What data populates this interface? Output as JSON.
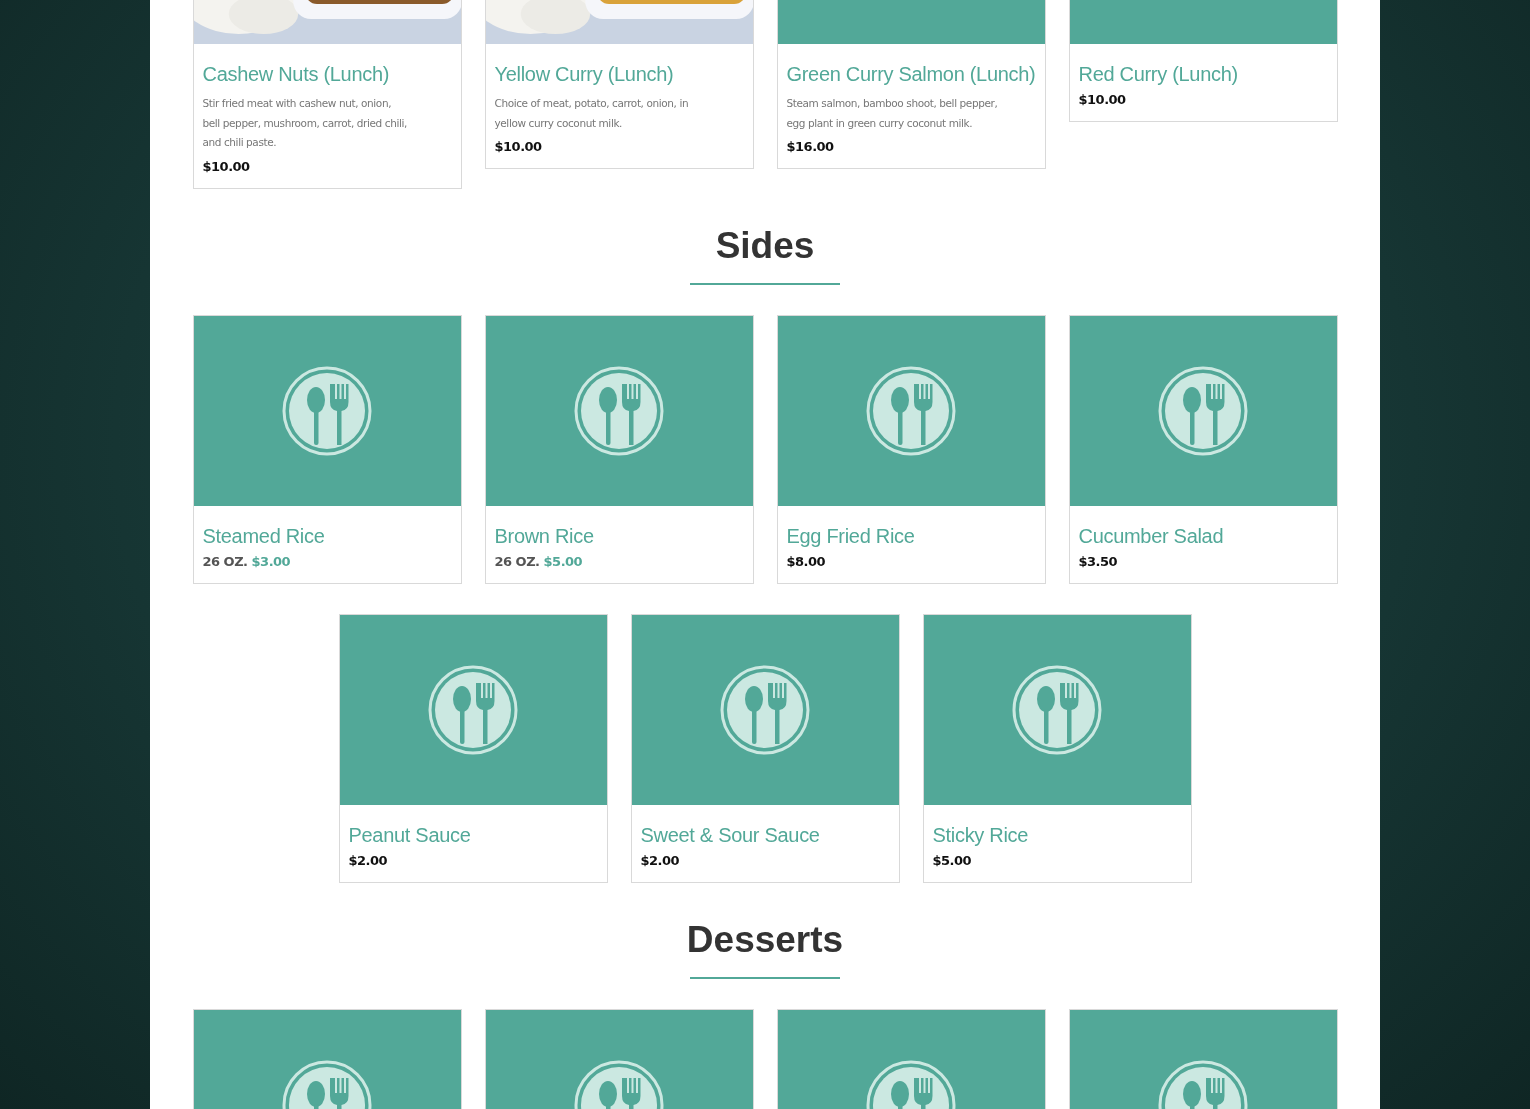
{
  "sections": [
    {
      "items": [
        {
          "name": "Cashew Nuts (Lunch)",
          "description": [
            "Stir fried meat with cashew nut, onion,",
            "bell pepper, mushroom, carrot, dried chili,",
            "and chili paste."
          ],
          "price": "$10.00"
        },
        {
          "name": "Yellow Curry (Lunch)",
          "description": [
            "Choice of meat, potato, carrot, onion, in",
            "yellow curry coconut milk."
          ],
          "price": "$10.00"
        },
        {
          "name": "Green Curry Salmon (Lunch)",
          "kind": "placeholder",
          "description": [
            "Steam salmon, bamboo shoot, bell pepper,",
            "egg plant in green curry coconut milk."
          ],
          "price": "$16.00"
        },
        {
          "name": "Red Curry (Lunch)",
          "kind": "placeholder",
          "price": "$10.00"
        }
      ]
    },
    {
      "title": "Sides",
      "items": [
        {
          "name": "Steamed Rice",
          "kind": "placeholder",
          "size": "26 OZ.",
          "price": "$3.00"
        },
        {
          "name": "Brown Rice",
          "kind": "placeholder",
          "size": "26 OZ.",
          "price": "$5.00"
        },
        {
          "name": "Egg Fried Rice",
          "kind": "placeholder",
          "price": "$8.00"
        },
        {
          "name": "Cucumber Salad",
          "kind": "placeholder",
          "price": "$3.50"
        },
        {
          "name": "Peanut Sauce",
          "kind": "placeholder",
          "price": "$2.00"
        },
        {
          "name": "Sweet & Sour Sauce",
          "kind": "placeholder",
          "price": "$2.00"
        },
        {
          "name": "Sticky Rice",
          "kind": "placeholder",
          "price": "$5.00"
        }
      ]
    },
    {
      "title": "Desserts",
      "items": [
        {
          "kind": "placeholder"
        },
        {
          "kind": "placeholder"
        },
        {
          "kind": "placeholder"
        },
        {
          "kind": "placeholder"
        }
      ]
    }
  ]
}
